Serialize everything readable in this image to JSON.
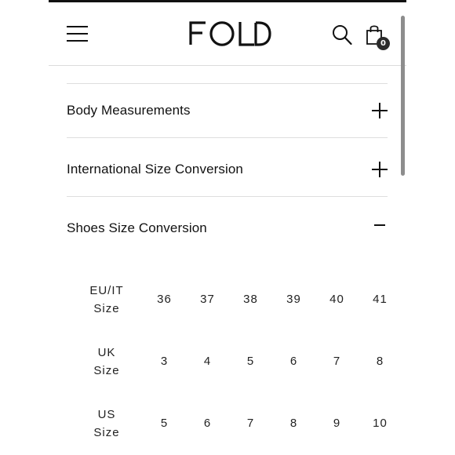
{
  "header": {
    "logo_text": "FOLD",
    "menu_icon": "hamburger-menu-icon",
    "search_icon": "search-icon",
    "cart_icon": "shopping-bag-icon",
    "cart_count": "0"
  },
  "accordion": [
    {
      "label": "Body Measurements",
      "state": "collapsed",
      "icon": "plus-icon"
    },
    {
      "label": "International Size Conversion",
      "state": "collapsed",
      "icon": "plus-icon"
    },
    {
      "label": "Shoes Size Conversion",
      "state": "expanded",
      "icon": "minus-icon"
    }
  ],
  "shoe_sizes": {
    "rows": [
      {
        "header_line1": "EU/IT",
        "header_line2": "Size",
        "values": [
          "36",
          "37",
          "38",
          "39",
          "40",
          "41"
        ]
      },
      {
        "header_line1": "UK",
        "header_line2": "Size",
        "values": [
          "3",
          "4",
          "5",
          "6",
          "7",
          "8"
        ]
      },
      {
        "header_line1": "US",
        "header_line2": "Size",
        "values": [
          "5",
          "6",
          "7",
          "8",
          "9",
          "10"
        ]
      }
    ]
  },
  "colors": {
    "text": "#111111",
    "divider": "#dedede",
    "scrollbar": "#8d8d8d",
    "badge": "#2b2b2b"
  }
}
